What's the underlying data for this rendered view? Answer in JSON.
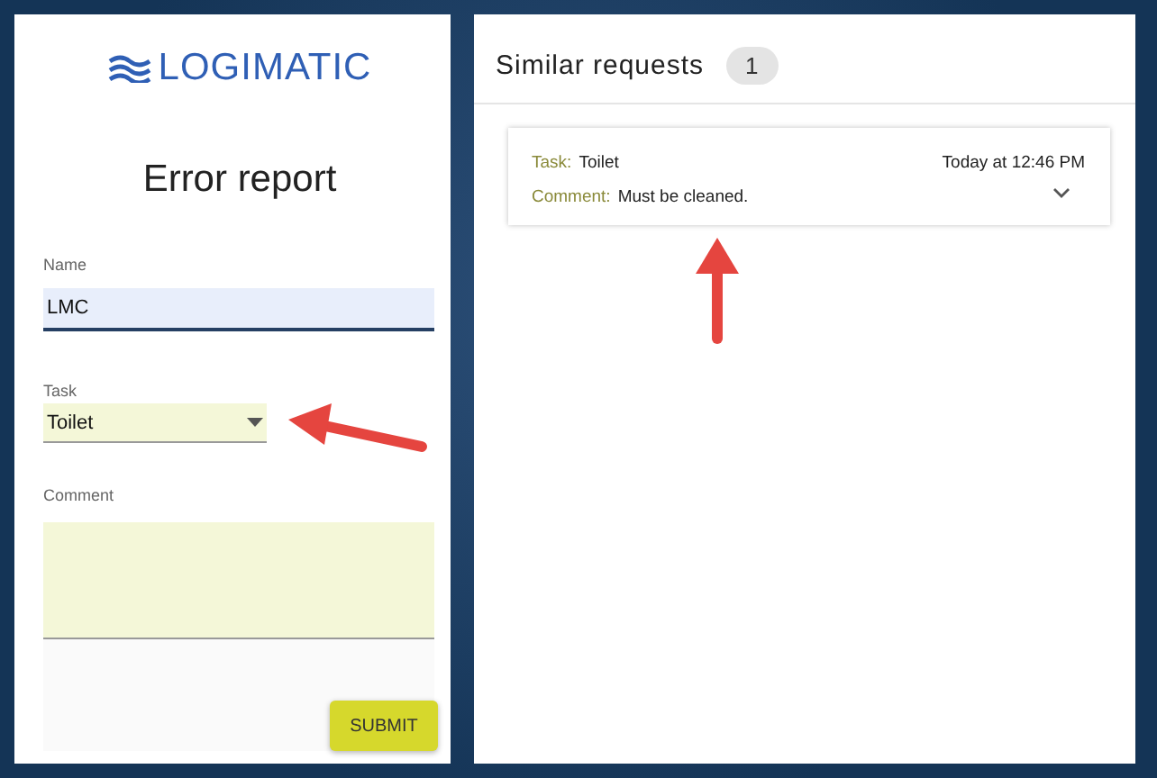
{
  "logo": {
    "text": "LOGIMATIC"
  },
  "form": {
    "title": "Error report",
    "name": {
      "label": "Name",
      "value": "LMC"
    },
    "task": {
      "label": "Task",
      "value": "Toilet"
    },
    "comment": {
      "label": "Comment"
    },
    "submit": "SUBMIT"
  },
  "similar": {
    "title": "Similar requests",
    "count": "1",
    "requests": [
      {
        "task_label": "Task:",
        "task": "Toilet",
        "comment_label": "Comment:",
        "comment": "Must be cleaned.",
        "time": "Today at 12:46 PM",
        "expanded": false
      }
    ]
  }
}
